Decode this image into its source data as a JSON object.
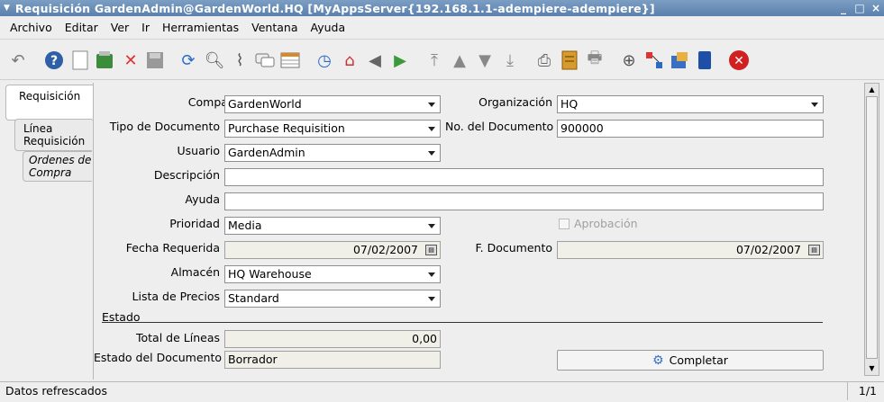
{
  "window": {
    "title": "Requisición  GardenAdmin@GardenWorld.HQ [MyAppsServer{192.168.1.1-adempiere-adempiere}]",
    "minimize_glyph": "_",
    "maximize_glyph": "□",
    "close_glyph": "×"
  },
  "menu": [
    "Archivo",
    "Editar",
    "Ver",
    "Ir",
    "Herramientas",
    "Ventana",
    "Ayuda"
  ],
  "toolbar": {
    "icons": [
      "undo-icon",
      "help-icon",
      "new-record-icon",
      "copy-record-icon",
      "delete-icon",
      "save-icon",
      "refresh-icon",
      "find-icon",
      "attachment-icon",
      "chat-icon",
      "grid-toggle-icon",
      "history-icon",
      "home-icon",
      "back-icon",
      "forward-icon",
      "first-record-icon",
      "previous-record-icon",
      "next-record-icon",
      "last-record-icon",
      "report-icon",
      "archive-icon",
      "print-icon",
      "zoom-across-icon",
      "workflow-icon",
      "request-icon",
      "product-info-icon",
      "close-window-icon"
    ]
  },
  "tabs": [
    {
      "label": "Requisición"
    },
    {
      "label": "Línea Requisición"
    },
    {
      "label": "Ordenes de Compra"
    }
  ],
  "form": {
    "company": {
      "label": "Compañía",
      "value": "GardenWorld"
    },
    "organization": {
      "label": "Organización",
      "value": "HQ"
    },
    "doc_type": {
      "label": "Tipo de Documento",
      "value": "Purchase Requisition"
    },
    "doc_no": {
      "label": "No. del Documento",
      "value": "900000"
    },
    "user": {
      "label": "Usuario",
      "value": "GardenAdmin"
    },
    "description": {
      "label": "Descripción",
      "value": ""
    },
    "help": {
      "label": "Ayuda",
      "value": ""
    },
    "priority": {
      "label": "Prioridad",
      "value": "Media"
    },
    "approval": {
      "label": "Aprobación",
      "checked": false
    },
    "date_required": {
      "label": "Fecha Requerida",
      "value": "07/02/2007"
    },
    "date_doc": {
      "label": "F. Documento",
      "value": "07/02/2007"
    },
    "warehouse": {
      "label": "Almacén",
      "value": "HQ Warehouse"
    },
    "price_list": {
      "label": "Lista de Precios",
      "value": "Standard"
    },
    "status_section": "Estado",
    "total_lines": {
      "label": "Total de Líneas",
      "value": "0,00"
    },
    "doc_status": {
      "label": "Estado del Documento",
      "value": "Borrador"
    },
    "complete_button": "Completar"
  },
  "status": {
    "message": "Datos refrescados",
    "record_count": "1/1"
  },
  "colors": {
    "titlebar": "#6b8fba",
    "readonly_field": "#f0f0e8"
  }
}
